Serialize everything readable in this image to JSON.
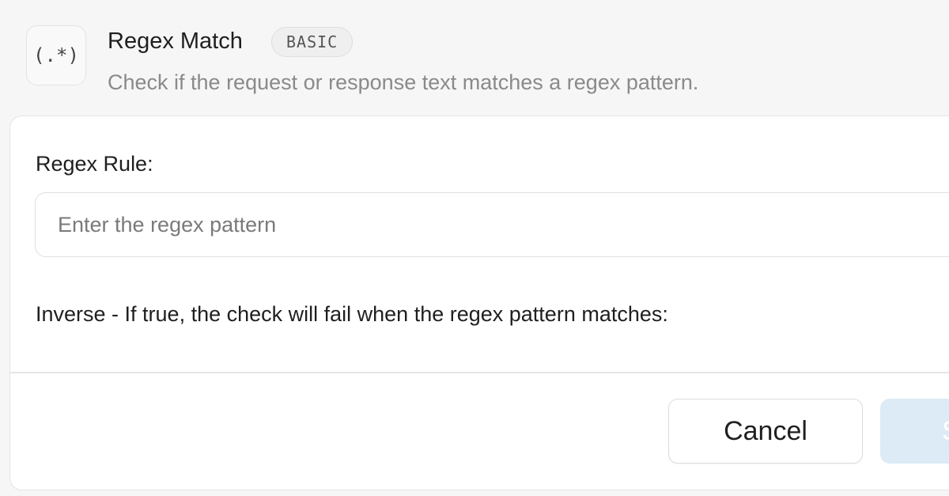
{
  "header": {
    "icon_glyph": "(.*)",
    "icon_name": "regex-icon",
    "title": "Regex Match",
    "badge": "BASIC",
    "subtitle": "Check if the request or response text matches a regex pattern."
  },
  "form": {
    "regex_label": "Regex Rule:",
    "regex_value": "",
    "regex_placeholder": "Enter the regex pattern",
    "inverse_label": "Inverse - If true, the check will fail when the regex pattern matches:"
  },
  "footer": {
    "cancel_label": "Cancel",
    "save_label": "S"
  },
  "colors": {
    "primary_button_bg": "#dcebf5",
    "badge_bg": "#efefef",
    "subtitle_text": "#8a8a8a"
  }
}
